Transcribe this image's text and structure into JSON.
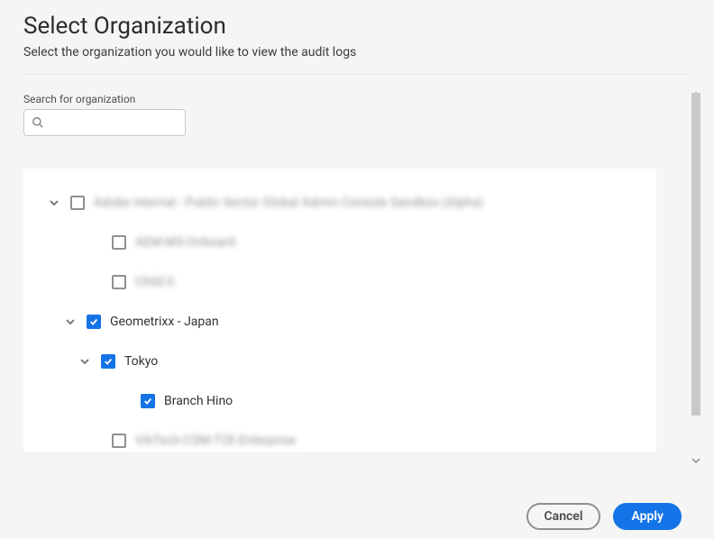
{
  "dialog": {
    "title": "Select Organization",
    "subtitle": "Select the organization you would like to view the audit logs"
  },
  "search": {
    "label": "Search for organization",
    "placeholder": ""
  },
  "tree": [
    {
      "indent": 0,
      "chevron": true,
      "checked": false,
      "blurred": true,
      "label": "Adobe Internal - Public Sector Global Admin Console Sandbox (Alpha)"
    },
    {
      "indent": 1,
      "chevron": false,
      "checked": false,
      "blurred": true,
      "label": "AEM-MS-Onboard"
    },
    {
      "indent": 1,
      "chevron": false,
      "checked": false,
      "blurred": true,
      "label": "Child 0"
    },
    {
      "indent": 1,
      "chevron": true,
      "indentOverride": 1,
      "checked": true,
      "blurred": false,
      "label": "Geometrixx - Japan"
    },
    {
      "indent": 2,
      "chevron": true,
      "checked": true,
      "blurred": false,
      "label": "Tokyo"
    },
    {
      "indent": 3,
      "chevron": false,
      "checked": true,
      "blurred": false,
      "label": "Branch Hino"
    },
    {
      "indent": 1,
      "chevron": false,
      "checked": false,
      "blurred": true,
      "label": "VikTech-CSM-T2E-Enterprise"
    }
  ],
  "buttons": {
    "cancel": "Cancel",
    "apply": "Apply"
  },
  "colors": {
    "accent": "#1473e6"
  }
}
